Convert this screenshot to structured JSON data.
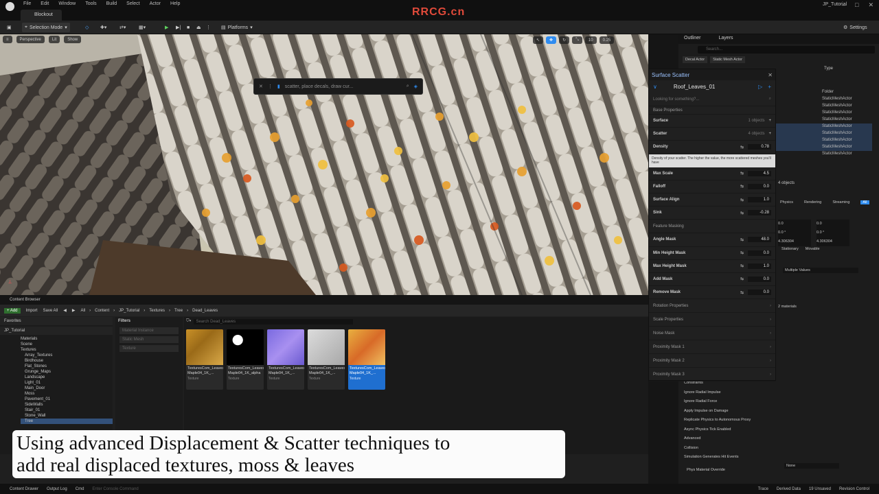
{
  "window": {
    "tab_label": "Blockout",
    "app_title": "JP_Tutorial",
    "menu": [
      "File",
      "Edit",
      "Window",
      "Tools",
      "Build",
      "Select",
      "Actor",
      "Help"
    ]
  },
  "toolbar": {
    "selection_mode": "Selection Mode",
    "platforms": "Platforms",
    "settings": "Settings"
  },
  "viewport": {
    "perspective": "Perspective",
    "lit": "Lit",
    "show": "Show",
    "search_placeholder": "scatter, place decals, draw cur...",
    "grid_value": "10",
    "scale_value": "0.25"
  },
  "scatter_panel": {
    "title": "Surface Scatter",
    "preset_name": "Roof_Leaves_01",
    "search_placeholder": "Looking for something?...",
    "base_properties": "Base Properties",
    "surface_label": "Surface",
    "surface_count": "1 objects",
    "scatter_label": "Scatter",
    "scatter_count": "4 objects",
    "density_label": "Density",
    "density_value": "0.78",
    "tooltip": "Density of your scatter. The higher the value, the more scattered meshes you'll have",
    "props": [
      {
        "label": "Max Scale",
        "value": "4.5"
      },
      {
        "label": "Falloff",
        "value": "0.0"
      },
      {
        "label": "Surface Align",
        "value": "1.0"
      },
      {
        "label": "Sink",
        "value": "-0.28"
      }
    ],
    "feature_masking": "Feature Masking",
    "mask_props": [
      {
        "label": "Angle Mask",
        "value": "48.0"
      },
      {
        "label": "Min Height Mask",
        "value": "0.0"
      },
      {
        "label": "Max Height Mask",
        "value": "1.0"
      },
      {
        "label": "Add Mask",
        "value": "0.0"
      },
      {
        "label": "Remove Mask",
        "value": "0.0"
      }
    ],
    "sections": [
      "Rotation Properties",
      "Scale Properties",
      "Noise Mask",
      "Proximity Mask 1",
      "Proximity Mask 2",
      "Proximity Mask 3"
    ]
  },
  "outliner": {
    "tab_outliner": "Outliner",
    "tab_layers": "Layers",
    "search_placeholder": "Search...",
    "filter_decal": "Decal Actor",
    "filter_static": "Static Mesh Actor",
    "col_type": "Type",
    "types": [
      "Folder",
      "StaticMeshActor",
      "StaticMeshActor",
      "StaticMeshActor",
      "StaticMeshActor",
      "StaticMeshActor",
      "StaticMeshActor",
      "StaticMeshActor",
      "StaticMeshActor",
      "StaticMeshActor"
    ]
  },
  "details": {
    "objects": "4 objects",
    "tabs": [
      "Physics",
      "Rendering",
      "Streaming",
      "All"
    ],
    "fields": [
      "0.0",
      "0.0",
      "0.0 °",
      "0.0 °",
      "4.306304",
      "4.306304"
    ],
    "mobility": [
      "Stationary",
      "Movable"
    ],
    "multiple_values": "Multiple Values",
    "materials": "2 materials",
    "constraints": "Constraints",
    "checks": [
      "Ignore Radial Impulse",
      "Ignore Radial Force",
      "Apply Impulse on Damage",
      "Replicate Physics to Autonomous Proxy",
      "Async Physics Tick Enabled"
    ],
    "advanced": "Advanced",
    "collision": "Collision",
    "sim_hit_events": "Simulation Generates Hit Events",
    "phys_material": "Phys Material Override",
    "none": "None"
  },
  "content_browser": {
    "tab": "Content Browser",
    "add": "Add",
    "import": "Import",
    "save_all": "Save All",
    "breadcrumb": [
      "All",
      "Content",
      "JP_Tutorial",
      "Textures",
      "Tree",
      "Dead_Leaves"
    ],
    "favorites": "Favorites",
    "root": "JP_Tutorial",
    "tree": [
      "Materials",
      "Scene",
      "Textures",
      "Array_Textures",
      "Birdhouse",
      "Flat_Stones",
      "Grunge_Maps",
      "Landscape",
      "Light_01",
      "Main_Door",
      "Moss",
      "Pavement_01",
      "SideWalls",
      "Stair_01",
      "Stone_Wall",
      "Tree"
    ],
    "filters_title": "Filters",
    "filters": [
      "Material Instance",
      "Static Mesh",
      "Texture"
    ],
    "search_placeholder": "Search Dead_Leaves",
    "assets": [
      {
        "name": "TexturesCom_Leaves_Norway Maple04_1K_...",
        "type": "Texture"
      },
      {
        "name": "TexturesCom_Leaves_Norway Maple04_1K_alpha",
        "type": "Texture"
      },
      {
        "name": "TexturesCom_Leaves_Norway Maple04_1K_...",
        "type": "Texture"
      },
      {
        "name": "TexturesCom_Leaves_Norway Maple04_1K_...",
        "type": "Texture"
      },
      {
        "name": "TexturesCom_Leaves_Norway Maple04_1K_...",
        "type": "Texture"
      }
    ]
  },
  "subtitle": {
    "line1": "Using advanced Displacement & Scatter techniques to",
    "line2": "add real displaced textures, moss & leaves"
  },
  "statusbar": {
    "content_drawer": "Content Drawer",
    "output_log": "Output Log",
    "cmd": "Cmd",
    "console_placeholder": "Enter Console Command",
    "trace": "Trace",
    "derived_data": "Derived Data",
    "unsaved": "19 Unsaved",
    "revision": "Revision Control"
  },
  "watermark": "RRCG.cn",
  "colors": {
    "accent_blue": "#2f8cf0",
    "panel": "#202020",
    "leaf_orange": "#e8a030"
  }
}
